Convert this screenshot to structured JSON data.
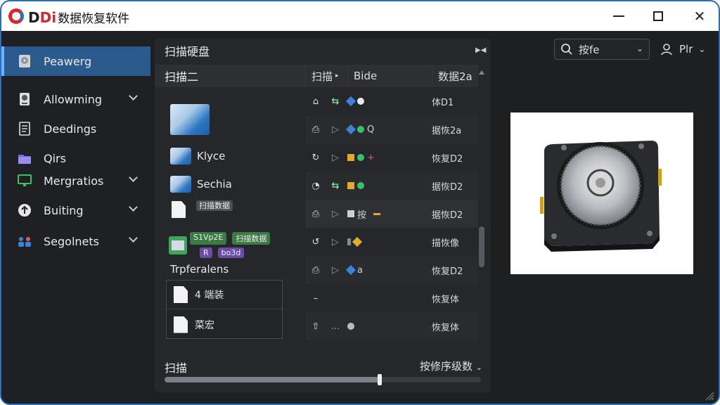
{
  "app": {
    "brand_prefix": "D",
    "brand_accent": "Di",
    "title_suffix": "数据恢复软件"
  },
  "sidebar": {
    "items": [
      {
        "label": "Peawerg",
        "icon": "disk-icon",
        "active": true,
        "has_children": false
      },
      {
        "label": "Allowming",
        "icon": "drive-icon",
        "active": false,
        "has_children": true
      },
      {
        "label": "Deedings",
        "icon": "document-icon",
        "active": false,
        "has_children": false
      },
      {
        "label": "Qirs",
        "icon": "folder-icon",
        "active": false,
        "has_children": false
      },
      {
        "label": "Mergratios",
        "icon": "monitor-icon",
        "active": false,
        "has_children": true
      },
      {
        "label": "Buiting",
        "icon": "settings-icon",
        "active": false,
        "has_children": true
      },
      {
        "label": "Segolnets",
        "icon": "people-icon",
        "active": false,
        "has_children": true
      }
    ]
  },
  "main": {
    "header": "扫描硬盘",
    "list_title": "扫描二",
    "columns": [
      "扫描",
      "Bide",
      "数据2a"
    ],
    "tree": [
      {
        "label": "",
        "type": "image"
      },
      {
        "label": "Klyce",
        "type": "image"
      },
      {
        "label": "Sechia",
        "type": "image"
      },
      {
        "label": "",
        "type": "document",
        "tag": "扫描数据"
      },
      {
        "label": "",
        "type": "gallery",
        "tags": [
          "S1Vp2E",
          "扫描数据",
          "R",
          "bo3d"
        ]
      },
      {
        "label": "Trpferalens",
        "type": "heading"
      }
    ],
    "subpanel": [
      {
        "label": "4 端装"
      },
      {
        "label": "菜宏"
      }
    ],
    "rows": [
      {
        "c1": "⌂",
        "c2": "⇆",
        "shapes": [
          "#3b83d8",
          "#e8e8e8"
        ],
        "text": "",
        "c4": "体D1"
      },
      {
        "c1": "⎙",
        "c2": "▷",
        "shapes": [
          "#3b83d8",
          "#34c36a"
        ],
        "text": "Q",
        "c4": "据恢2a"
      },
      {
        "c1": "↻",
        "c2": "▷",
        "shapes": [
          "#e2a92d",
          "#34c36a"
        ],
        "text": "+",
        "c4": "恢复D2"
      },
      {
        "c1": "◔",
        "c2": "⇆",
        "shapes": [
          "#e2a92d",
          "#34c36a"
        ],
        "text": "",
        "c4": "据恢D2"
      },
      {
        "c1": "⎙",
        "c2": "▷",
        "shapes": [
          "#cfcfcf"
        ],
        "text": "按",
        "c4": "据恢D2"
      },
      {
        "c1": "↺",
        "c2": "▷",
        "shapes": [
          "#888888",
          "#e2a92d"
        ],
        "text": "",
        "c4": "描恢像"
      },
      {
        "c1": "⎙",
        "c2": "▷",
        "shapes": [
          "#3b83d8"
        ],
        "text": "a",
        "c4": "恢复D2"
      },
      {
        "c1": "–",
        "c2": "",
        "shapes": [],
        "text": "",
        "c4": "恢复体"
      },
      {
        "c1": "⇧",
        "c2": "…",
        "shapes": [
          "#bbbbbb"
        ],
        "text": "",
        "c4": "恢复体"
      }
    ],
    "footer": {
      "label": "扫描",
      "right": "按修序级数",
      "progress": 0.68
    }
  },
  "search": {
    "value": "按fe"
  },
  "user": {
    "label": "Plr"
  },
  "colors": {
    "accent": "#2b5a8c",
    "accent_border": "#6fb0ff",
    "background": "#1e1f21",
    "panel": "#26272a"
  }
}
